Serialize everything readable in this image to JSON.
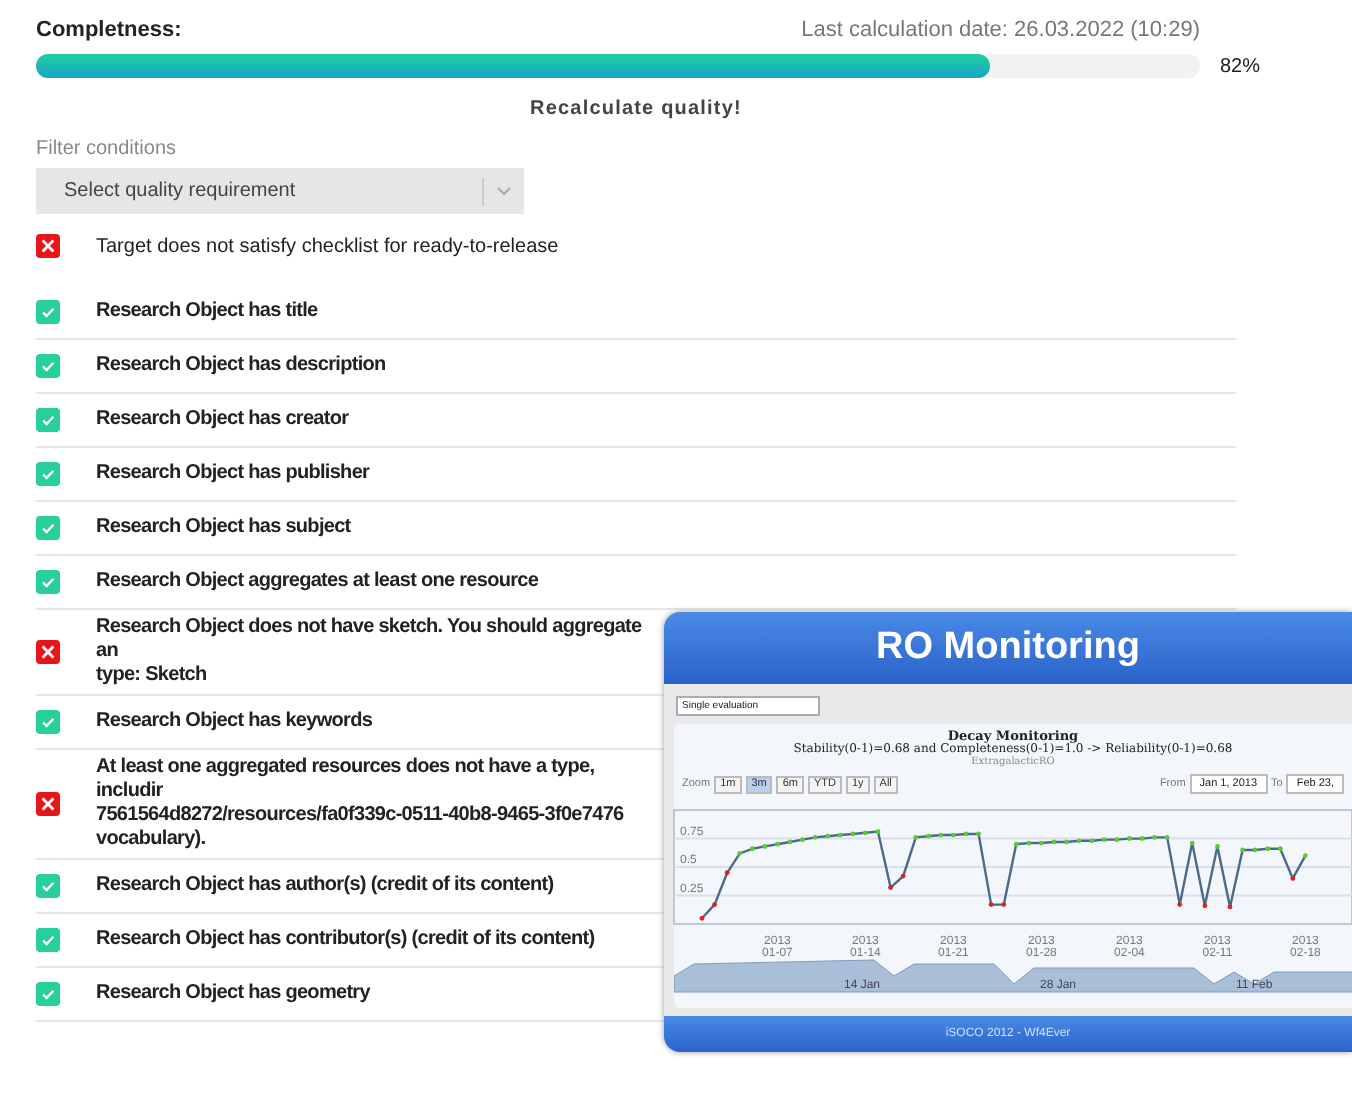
{
  "header": {
    "label": "Completness:",
    "last_calculation": "Last calculation date: 26.03.2022 (10:29)"
  },
  "progress": {
    "level": 0.82,
    "reading": "82%"
  },
  "recalculate_button": "Recalculate quality!",
  "filter": {
    "label": "Filter conditions",
    "placeholder": "Select quality requirement"
  },
  "summary": {
    "passed": false,
    "text": "Target does not satisfy checklist for ready-to-release"
  },
  "checks": [
    {
      "passed": true,
      "lines": [
        "Research Object has title"
      ]
    },
    {
      "passed": true,
      "lines": [
        "Research Object has description"
      ]
    },
    {
      "passed": true,
      "lines": [
        "Research Object has creator"
      ]
    },
    {
      "passed": true,
      "lines": [
        "Research Object has publisher"
      ]
    },
    {
      "passed": true,
      "lines": [
        "Research Object has subject"
      ]
    },
    {
      "passed": true,
      "lines": [
        "Research Object aggregates at least one resource"
      ]
    },
    {
      "passed": false,
      "lines": [
        "Research Object does not have sketch. You should aggregate an",
        "type: Sketch"
      ]
    },
    {
      "passed": true,
      "lines": [
        "Research Object has keywords"
      ]
    },
    {
      "passed": false,
      "lines": [
        "At least one aggregated resources does not have a type, includir",
        "7561564d8272/resources/fa0f339c-0511-40b8-9465-3f0e7476",
        "vocabulary)."
      ]
    },
    {
      "passed": true,
      "lines": [
        "Research Object has author(s) (credit of its content)"
      ]
    },
    {
      "passed": true,
      "lines": [
        "Research Object has contributor(s) (credit of its content)"
      ]
    },
    {
      "passed": true,
      "lines": [
        "Research Object has geometry"
      ]
    }
  ],
  "monitoring": {
    "title": "RO Monitoring",
    "mode": "Single evaluation",
    "chart_title": "Decay Monitoring",
    "chart_subtitle": "Stability(0-1)=0.68 and Completeness(0-1)=1.0 -> Reliability(0-1)=0.68",
    "chart_caption": "ExtragalacticRO",
    "zoom_label": "Zoom",
    "zoom_buttons": [
      {
        "label": "1m",
        "selected": false
      },
      {
        "label": "3m",
        "selected": true
      },
      {
        "label": "6m",
        "selected": false
      },
      {
        "label": "YTD",
        "selected": false
      },
      {
        "label": "1y",
        "selected": false
      },
      {
        "label": "All",
        "selected": false
      }
    ],
    "from_label": "From",
    "from_value": "Jan 1, 2013",
    "to_label": "To",
    "to_value": "Feb 23,",
    "chart_data": {
      "type": "line",
      "grid": true,
      "ylim": [
        0,
        1
      ],
      "yticks": [
        {
          "value": 0.75,
          "label": "0.75"
        },
        {
          "value": 0.5,
          "label": "0.5"
        },
        {
          "value": 0.25,
          "label": "0.25"
        }
      ],
      "categories": [
        null,
        null,
        null,
        null,
        null,
        null,
        "2013 01-07",
        null,
        null,
        null,
        null,
        null,
        null,
        "2013 01-14",
        null,
        null,
        null,
        null,
        null,
        null,
        "2013 01-21",
        null,
        null,
        null,
        null,
        null,
        null,
        "2013 01-28",
        null,
        null,
        null,
        null,
        null,
        null,
        "2013 02-04",
        null,
        null,
        null,
        null,
        null,
        null,
        "2013 02-11",
        null,
        null,
        null,
        null,
        null,
        null,
        "2013 02-18"
      ],
      "series": [
        {
          "color": "#4a6a8a",
          "values": [
            0.05,
            0.17,
            0.45,
            0.62,
            0.66,
            0.68,
            0.7,
            0.72,
            0.74,
            0.76,
            0.77,
            0.78,
            0.79,
            0.8,
            0.81,
            0.32,
            0.42,
            0.76,
            0.77,
            0.78,
            0.78,
            0.79,
            0.79,
            0.17,
            0.17,
            0.7,
            0.71,
            0.71,
            0.72,
            0.72,
            0.73,
            0.73,
            0.74,
            0.74,
            0.75,
            0.75,
            0.76,
            0.76,
            0.17,
            0.71,
            0.16,
            0.68,
            0.15,
            0.65,
            0.65,
            0.66,
            0.66,
            0.4,
            0.6
          ]
        }
      ]
    },
    "navigator_labels": [
      "14 Jan",
      "28 Jan",
      "11 Feb"
    ],
    "footer": "iSOCO 2012 - Wf4Ever"
  }
}
